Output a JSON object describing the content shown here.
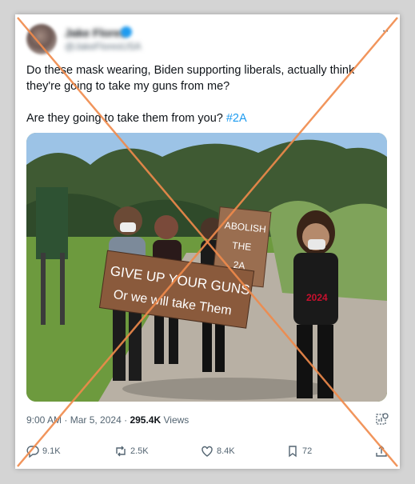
{
  "header": {
    "name": "Jake Flores",
    "handle": "@JakeFloresUSA",
    "more_label": "··"
  },
  "tweet": {
    "line1": "Do these mask wearing, Biden supporting liberals, actually think they're going to take my guns from me?",
    "line2_prefix": "Are they going to take them from you?",
    "hashtag": "#2A"
  },
  "photo": {
    "sign_main_line1": "GIVE UP YOUR GUNS",
    "sign_main_line2": "Or we will take Them",
    "sign_small_line1": "ABOLISH",
    "sign_small_line2": "THE",
    "sign_small_line3": "2A",
    "shirt_text": "2024"
  },
  "meta": {
    "time": "9:00 AM",
    "separator": "·",
    "date": "Mar 5, 2024",
    "views_count": "295.4K",
    "views_label": "Views"
  },
  "actions": {
    "replies": "9.1K",
    "reposts": "2.5K",
    "likes": "8.4K",
    "bookmarks": "72"
  },
  "colors": {
    "link": "#1d9bf0",
    "muted": "#536471",
    "cross": "#f08a4b"
  }
}
